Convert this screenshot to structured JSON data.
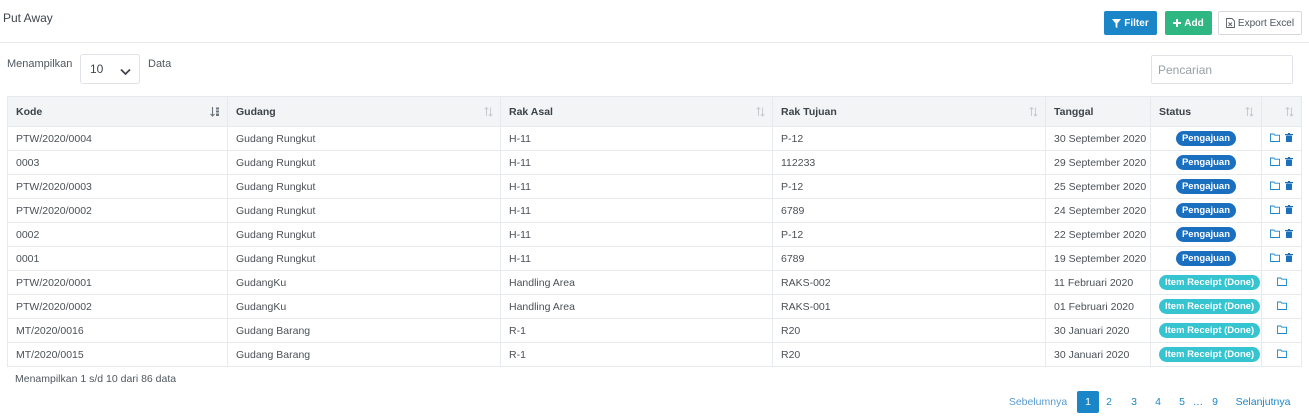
{
  "header": {
    "title": "Put Away",
    "filter_label": "Filter",
    "add_label": "Add",
    "export_label": "Export Excel"
  },
  "controls": {
    "show_label": "Menampilkan",
    "page_size": "10",
    "data_label": "Data",
    "search_placeholder": "Pencarian"
  },
  "table": {
    "columns": [
      "Kode",
      "Gudang",
      "Rak Asal",
      "Rak Tujuan",
      "Tanggal",
      "Status"
    ],
    "rows": [
      {
        "kode": "PTW/2020/0004",
        "gudang": "Gudang Rungkut",
        "rak_asal": "H-11",
        "rak_tujuan": "P-12",
        "tanggal": "30 September 2020",
        "status": "Pengajuan"
      },
      {
        "kode": "0003",
        "gudang": "Gudang Rungkut",
        "rak_asal": "H-11",
        "rak_tujuan": "112233",
        "tanggal": "29 September 2020",
        "status": "Pengajuan"
      },
      {
        "kode": "PTW/2020/0003",
        "gudang": "Gudang Rungkut",
        "rak_asal": "H-11",
        "rak_tujuan": "P-12",
        "tanggal": "25 September 2020",
        "status": "Pengajuan"
      },
      {
        "kode": "PTW/2020/0002",
        "gudang": "Gudang Rungkut",
        "rak_asal": "H-11",
        "rak_tujuan": "6789",
        "tanggal": "24 September 2020",
        "status": "Pengajuan"
      },
      {
        "kode": "0002",
        "gudang": "Gudang Rungkut",
        "rak_asal": "H-11",
        "rak_tujuan": "P-12",
        "tanggal": "22 September 2020",
        "status": "Pengajuan"
      },
      {
        "kode": "0001",
        "gudang": "Gudang Rungkut",
        "rak_asal": "H-11",
        "rak_tujuan": "6789",
        "tanggal": "19 September 2020",
        "status": "Pengajuan"
      },
      {
        "kode": "PTW/2020/0001",
        "gudang": "GudangKu",
        "rak_asal": "Handling Area",
        "rak_tujuan": "RAKS-002",
        "tanggal": "11 Februari 2020",
        "status": "Item Receipt (Done)"
      },
      {
        "kode": "PTW/2020/0002",
        "gudang": "GudangKu",
        "rak_asal": "Handling Area",
        "rak_tujuan": "RAKS-001",
        "tanggal": "01 Februari 2020",
        "status": "Item Receipt (Done)"
      },
      {
        "kode": "MT/2020/0016",
        "gudang": "Gudang Barang",
        "rak_asal": "R-1",
        "rak_tujuan": "R20",
        "tanggal": "30 Januari 2020",
        "status": "Item Receipt (Done)"
      },
      {
        "kode": "MT/2020/0015",
        "gudang": "Gudang Barang",
        "rak_asal": "R-1",
        "rak_tujuan": "R20",
        "tanggal": "30 Januari 2020",
        "status": "Item Receipt (Done)"
      }
    ]
  },
  "footer": {
    "info": "Menampilkan 1 s/d 10 dari 86 data",
    "prev_label": "Sebelumnya",
    "next_label": "Selanjutnya",
    "pages": [
      "1",
      "2",
      "3",
      "4",
      "5",
      "…",
      "9"
    ],
    "active_page": "1"
  },
  "colors": {
    "primary": "#1a86c8",
    "success": "#2fb783",
    "badge_pengajuan": "#1a6fbf",
    "badge_done": "#35c4d0"
  },
  "icons": {
    "filter": "filter-icon",
    "add": "plus-icon",
    "export": "file-excel-icon",
    "detail": "folder-icon",
    "delete": "trash-icon",
    "sort": "sort-icon"
  }
}
